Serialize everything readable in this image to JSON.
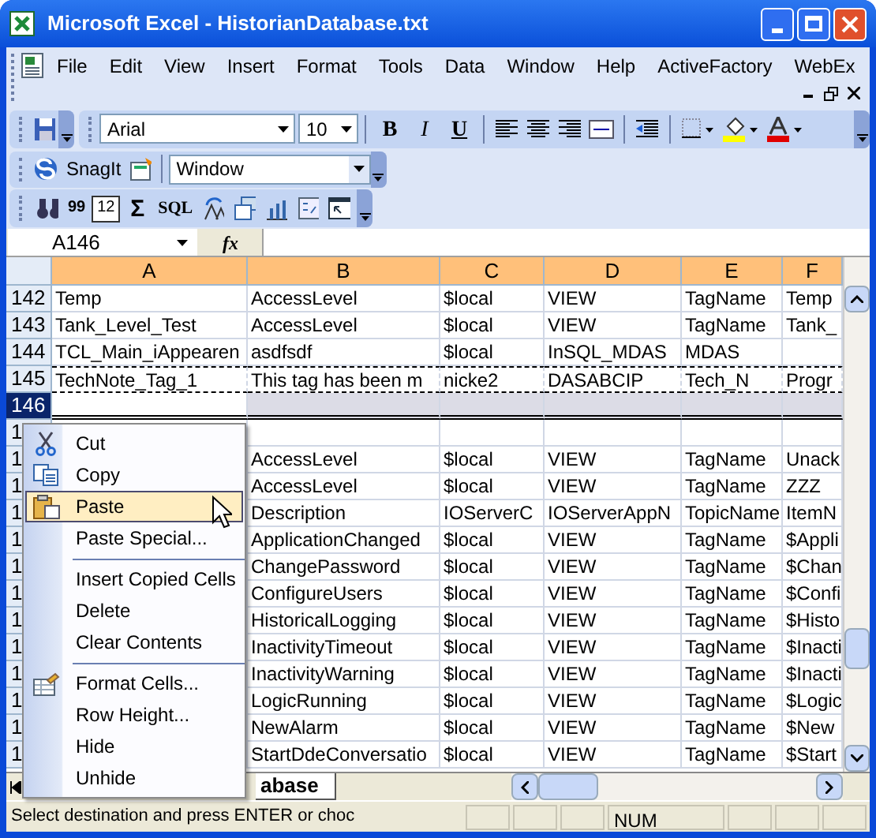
{
  "window": {
    "title": "Microsoft Excel - HistorianDatabase.txt"
  },
  "menu_bar": {
    "items": [
      "File",
      "Edit",
      "View",
      "Insert",
      "Format",
      "Tools",
      "Data",
      "Window",
      "Help",
      "ActiveFactory",
      "WebEx"
    ]
  },
  "formatting_toolbar": {
    "font": "Arial",
    "size": "10",
    "style_buttons": [
      "B",
      "I",
      "U"
    ]
  },
  "snagit_toolbar": {
    "label": "SnagIt",
    "dropdown": "Window"
  },
  "custom_toolbar": {
    "counter": "99",
    "calendar": "12",
    "sum": "Σ",
    "sql": "SQL"
  },
  "formula_bar": {
    "name_box": "A146",
    "fx": "fx"
  },
  "grid": {
    "columns": [
      {
        "label": "A",
        "selected": true
      },
      {
        "label": "B",
        "selected": true
      },
      {
        "label": "C",
        "selected": true
      },
      {
        "label": "D",
        "selected": true
      },
      {
        "label": "E",
        "selected": true
      },
      {
        "label": "F",
        "selected": true
      }
    ],
    "rows": [
      {
        "number": "142",
        "selected": false,
        "marquee": false,
        "cells": {
          "A": "Temp",
          "B": "AccessLevel",
          "C": "$local",
          "D": "VIEW",
          "E": "TagName",
          "F": "Temp"
        }
      },
      {
        "number": "143",
        "selected": false,
        "marquee": false,
        "cells": {
          "A": "Tank_Level_Test",
          "B": "AccessLevel",
          "C": "$local",
          "D": "VIEW",
          "E": "TagName",
          "F": "Tank_"
        }
      },
      {
        "number": "144",
        "selected": false,
        "marquee": false,
        "cells": {
          "A": "TCL_Main_iAppearen",
          "B": "asdfsdf",
          "C": "$local",
          "D": "InSQL_MDAS",
          "E": "MDAS"
        }
      },
      {
        "number": "145",
        "selected": false,
        "marquee": true,
        "cells": {
          "A": "TechNote_Tag_1",
          "B": "This tag has been m",
          "C": "nicke2",
          "D": "DASABCIP",
          "E": "Tech_N",
          "F": "Progr"
        }
      },
      {
        "number": "146",
        "selected": true,
        "marquee": false,
        "cells": {}
      },
      {
        "number": "1",
        "selected": false,
        "marquee": false,
        "cells": {}
      },
      {
        "number": "1",
        "selected": false,
        "marquee": false,
        "cells": {
          "B": "AccessLevel",
          "C": "$local",
          "D": "VIEW",
          "E": "TagName",
          "F": "Unack"
        }
      },
      {
        "number": "1",
        "selected": false,
        "marquee": false,
        "cells": {
          "B": "AccessLevel",
          "C": "$local",
          "D": "VIEW",
          "E": "TagName",
          "F": "ZZZ"
        }
      },
      {
        "number": "1",
        "selected": false,
        "marquee": false,
        "cells": {
          "B": "Description",
          "C": "IOServerC",
          "D": "IOServerAppN",
          "E": "TopicName",
          "F": "ItemN"
        }
      },
      {
        "number": "1",
        "selected": false,
        "marquee": false,
        "cells": {
          "B": "ApplicationChanged",
          "C": "$local",
          "D": "VIEW",
          "E": "TagName",
          "F": "$Appli"
        }
      },
      {
        "number": "1",
        "selected": false,
        "marquee": false,
        "cells": {
          "B": "ChangePassword",
          "C": "$local",
          "D": "VIEW",
          "E": "TagName",
          "F": "$Chan"
        }
      },
      {
        "number": "1",
        "selected": false,
        "marquee": false,
        "cells": {
          "B": "ConfigureUsers",
          "C": "$local",
          "D": "VIEW",
          "E": "TagName",
          "F": "$Confi"
        }
      },
      {
        "number": "1",
        "selected": false,
        "marquee": false,
        "cells": {
          "B": "HistoricalLogging",
          "C": "$local",
          "D": "VIEW",
          "E": "TagName",
          "F": "$Histo"
        }
      },
      {
        "number": "1",
        "selected": false,
        "marquee": false,
        "cells": {
          "B": "InactivityTimeout",
          "C": "$local",
          "D": "VIEW",
          "E": "TagName",
          "F": "$Inacti"
        }
      },
      {
        "number": "1",
        "selected": false,
        "marquee": false,
        "cells": {
          "B": "InactivityWarning",
          "C": "$local",
          "D": "VIEW",
          "E": "TagName",
          "F": "$Inacti"
        }
      },
      {
        "number": "1",
        "selected": false,
        "marquee": false,
        "cells": {
          "B": "LogicRunning",
          "C": "$local",
          "D": "VIEW",
          "E": "TagName",
          "F": "$Logic"
        }
      },
      {
        "number": "1",
        "selected": false,
        "marquee": false,
        "cells": {
          "B": "NewAlarm",
          "C": "$local",
          "D": "VIEW",
          "E": "TagName",
          "F": "$New"
        }
      },
      {
        "number": "1",
        "selected": false,
        "marquee": false,
        "cells": {
          "B": "StartDdeConversatio",
          "C": "$local",
          "D": "VIEW",
          "E": "TagName",
          "F": "$Start"
        }
      }
    ]
  },
  "context_menu": {
    "items": [
      {
        "kind": "cut",
        "label": "Cut",
        "selected": false
      },
      {
        "kind": "copy",
        "label": "Copy",
        "selected": false
      },
      {
        "kind": "paste",
        "label": "Paste",
        "selected": true
      },
      {
        "kind": "plain",
        "label": "Paste Special...",
        "selected": false
      },
      {
        "kind": "separator"
      },
      {
        "kind": "plain",
        "label": "Insert Copied Cells",
        "selected": false
      },
      {
        "kind": "plain",
        "label": "Delete",
        "selected": false
      },
      {
        "kind": "plain",
        "label": "Clear Contents",
        "selected": false
      },
      {
        "kind": "separator"
      },
      {
        "kind": "format",
        "label": "Format Cells...",
        "selected": false
      },
      {
        "kind": "plain",
        "label": "Row Height...",
        "selected": false
      },
      {
        "kind": "plain",
        "label": "Hide",
        "selected": false
      },
      {
        "kind": "plain",
        "label": "Unhide",
        "selected": false
      }
    ]
  },
  "sheet_tabs": [
    {
      "label": "abase",
      "selected": true
    }
  ],
  "status_bar": {
    "message": "Select destination and press ENTER or choc",
    "indicators": [
      "NUM"
    ]
  }
}
